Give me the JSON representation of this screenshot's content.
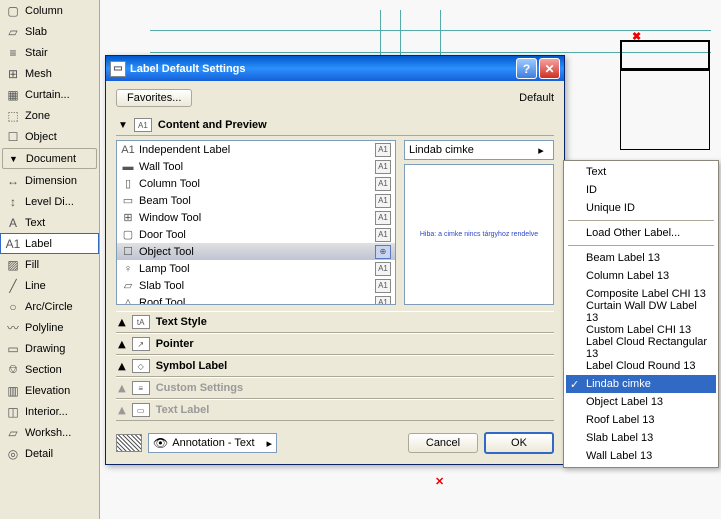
{
  "toolbox": {
    "items_top": [
      {
        "label": "Column",
        "icon": "▢"
      },
      {
        "label": "Slab",
        "icon": "▱"
      },
      {
        "label": "Stair",
        "icon": "≡"
      },
      {
        "label": "Mesh",
        "icon": "⊞"
      },
      {
        "label": "Curtain...",
        "icon": "▦"
      },
      {
        "label": "Zone",
        "icon": "⬚"
      },
      {
        "label": "Object",
        "icon": "☐"
      }
    ],
    "header": "Document",
    "items_doc": [
      {
        "label": "Dimension",
        "icon": "↔"
      },
      {
        "label": "Level Di...",
        "icon": "↕"
      },
      {
        "label": "Text",
        "icon": "A"
      },
      {
        "label": "Label",
        "icon": "A1",
        "sel": true
      },
      {
        "label": "Fill",
        "icon": "▨"
      },
      {
        "label": "Line",
        "icon": "╱"
      },
      {
        "label": "Arc/Circle",
        "icon": "○"
      },
      {
        "label": "Polyline",
        "icon": "〰"
      },
      {
        "label": "Drawing",
        "icon": "▭"
      },
      {
        "label": "Section",
        "icon": "⎊"
      },
      {
        "label": "Elevation",
        "icon": "▥"
      },
      {
        "label": "Interior...",
        "icon": "◫"
      },
      {
        "label": "Worksh...",
        "icon": "▱"
      },
      {
        "label": "Detail",
        "icon": "◎"
      }
    ]
  },
  "dialog": {
    "title": "Label Default Settings",
    "favorites_btn": "Favorites...",
    "default_label": "Default",
    "section_header": "Content and Preview",
    "tool_list": [
      {
        "label": "Independent Label",
        "icon": "A1"
      },
      {
        "label": "Wall Tool",
        "icon": "▬"
      },
      {
        "label": "Column Tool",
        "icon": "▯"
      },
      {
        "label": "Beam Tool",
        "icon": "▭"
      },
      {
        "label": "Window Tool",
        "icon": "⊞"
      },
      {
        "label": "Door Tool",
        "icon": "▢"
      },
      {
        "label": "Object Tool",
        "icon": "☐",
        "sel": true
      },
      {
        "label": "Lamp Tool",
        "icon": "♀"
      },
      {
        "label": "Slab Tool",
        "icon": "▱"
      },
      {
        "label": "Roof Tool",
        "icon": "△"
      }
    ],
    "label_type_combo": "Lindab cimke",
    "preview_msg": "Hiba: a cimke nincs tárgyhoz rendelve",
    "collapsed_sections": [
      {
        "label": "Text Style",
        "icon": "tA",
        "enabled": true
      },
      {
        "label": "Pointer",
        "icon": "↗",
        "enabled": true
      },
      {
        "label": "Symbol Label",
        "icon": "◇",
        "enabled": true
      },
      {
        "label": "Custom Settings",
        "icon": "≡",
        "enabled": false
      },
      {
        "label": "Text Label",
        "icon": "▭",
        "enabled": false
      }
    ],
    "annotation_combo": "Annotation - Text",
    "cancel": "Cancel",
    "ok": "OK"
  },
  "context_menu": {
    "group1": [
      "Text",
      "ID",
      "Unique ID"
    ],
    "group2": [
      "Load Other Label..."
    ],
    "group3": [
      "Beam Label 13",
      "Column Label 13",
      "Composite Label CHI 13",
      "Curtain Wall DW Label 13",
      "Custom Label CHI 13",
      "Label Cloud Rectangular 13",
      "Label Cloud Round 13",
      "Lindab cimke",
      "Object Label 13",
      "Roof Label 13",
      "Slab Label 13",
      "Wall Label 13"
    ],
    "selected": "Lindab cimke"
  }
}
